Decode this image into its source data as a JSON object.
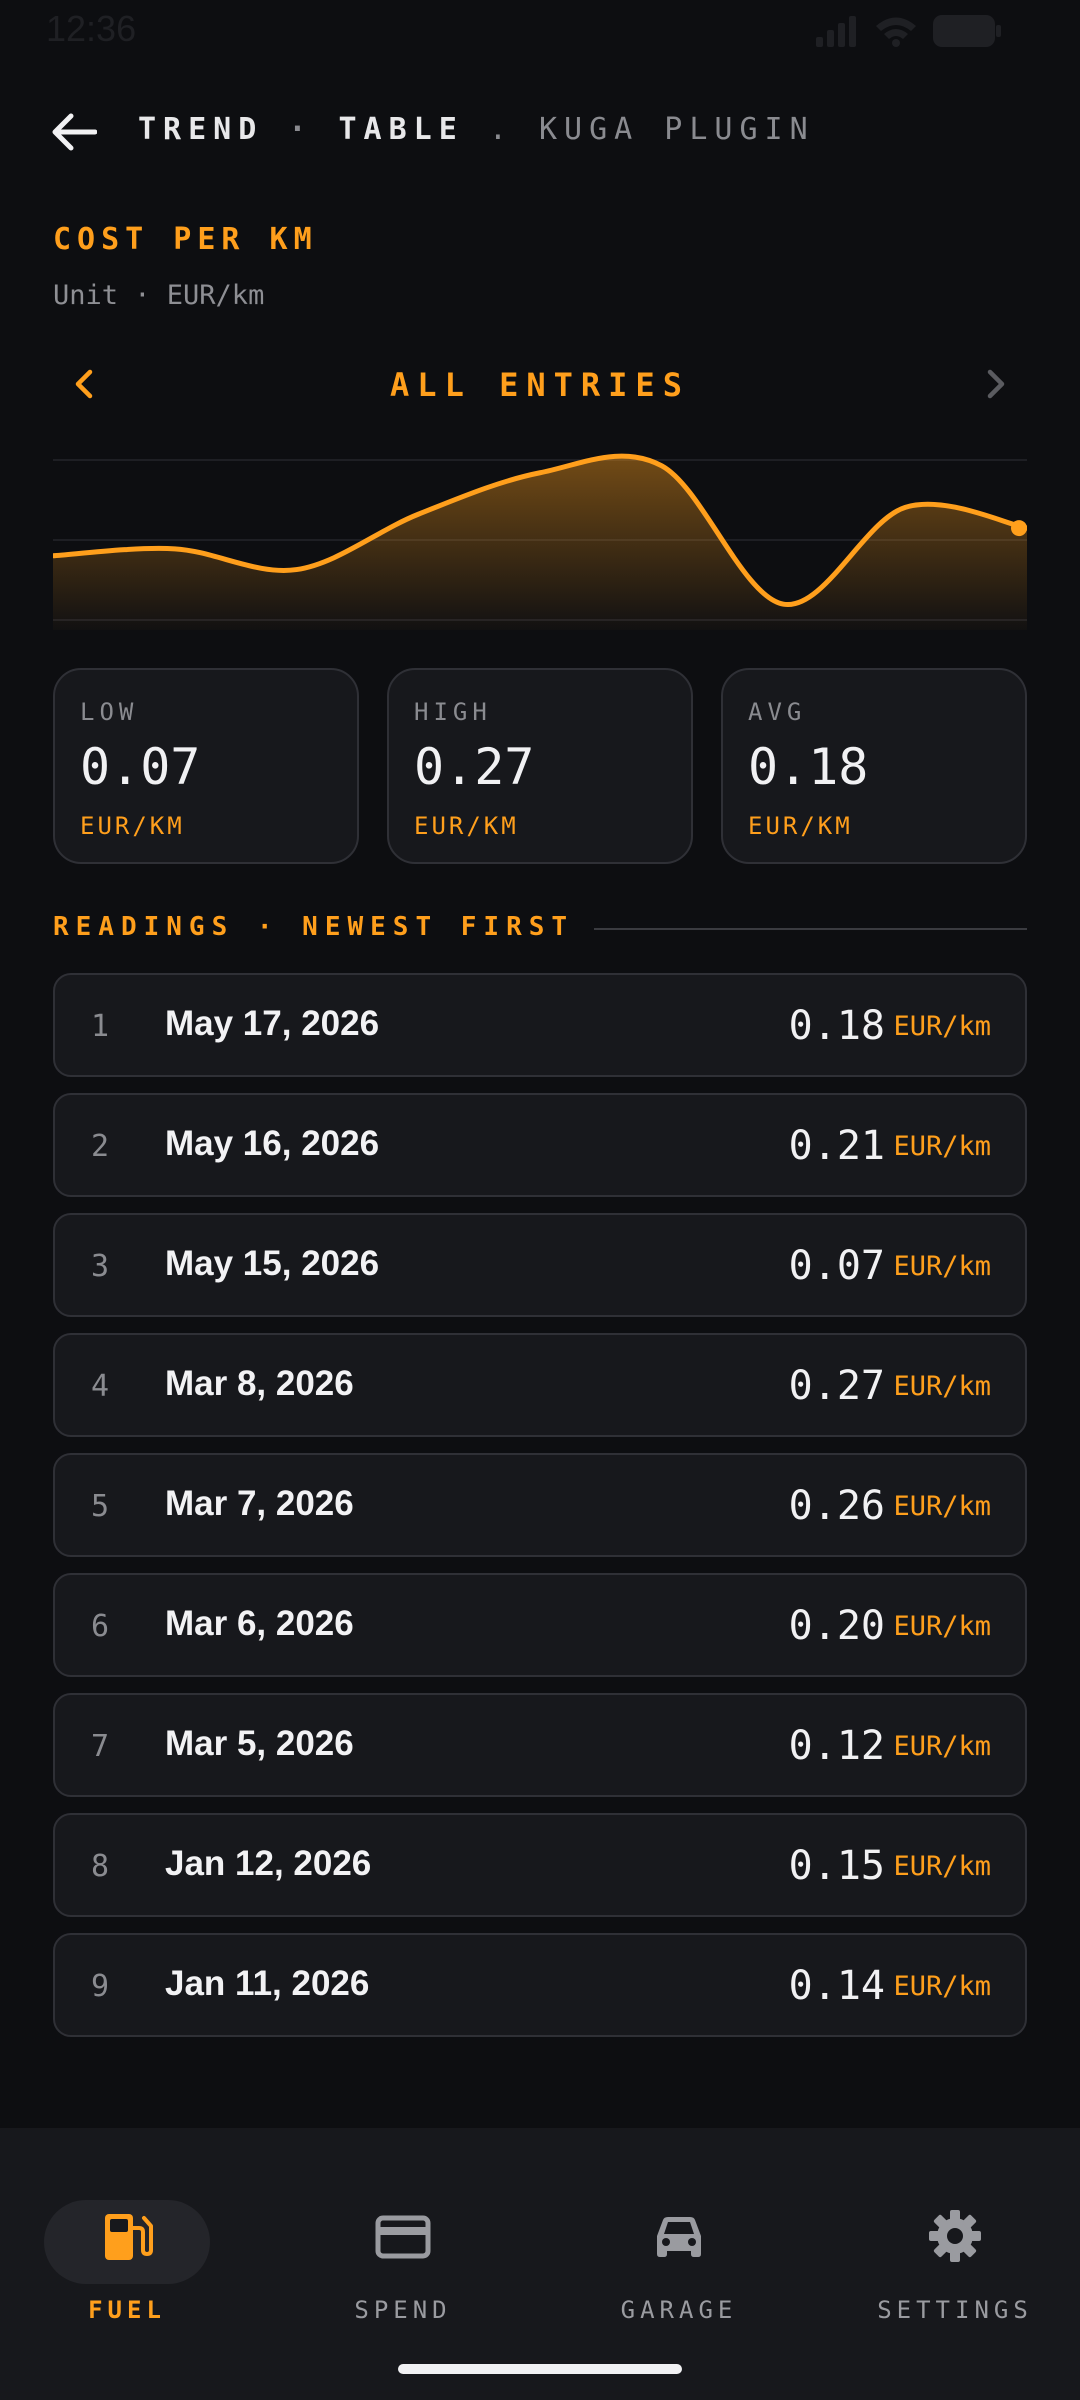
{
  "status": {
    "time": "12:36"
  },
  "header": {
    "crumb_trend": "TREND",
    "crumb_sep": "·",
    "crumb_table": "TABLE",
    "crumb_dot": ".",
    "crumb_vehicle": "KUGA PLUGIN"
  },
  "metric": {
    "title": "COST PER KM",
    "unit_line": "Unit · EUR/km"
  },
  "range": {
    "label": "ALL ENTRIES"
  },
  "colors": {
    "accent": "#ff9f1c",
    "background": "#0d0e11",
    "card": "#17181c"
  },
  "stats": [
    {
      "label": "LOW",
      "value": "0.07",
      "unit": "EUR/KM"
    },
    {
      "label": "HIGH",
      "value": "0.27",
      "unit": "EUR/KM"
    },
    {
      "label": "AVG",
      "value": "0.18",
      "unit": "EUR/KM"
    }
  ],
  "section": {
    "label": "READINGS · NEWEST FIRST"
  },
  "readings": [
    {
      "index": "1",
      "date": "May 17, 2026",
      "value": "0.18",
      "unit": "EUR/km"
    },
    {
      "index": "2",
      "date": "May 16, 2026",
      "value": "0.21",
      "unit": "EUR/km"
    },
    {
      "index": "3",
      "date": "May 15, 2026",
      "value": "0.07",
      "unit": "EUR/km"
    },
    {
      "index": "4",
      "date": "Mar 8, 2026",
      "value": "0.27",
      "unit": "EUR/km"
    },
    {
      "index": "5",
      "date": "Mar 7, 2026",
      "value": "0.26",
      "unit": "EUR/km"
    },
    {
      "index": "6",
      "date": "Mar 6, 2026",
      "value": "0.20",
      "unit": "EUR/km"
    },
    {
      "index": "7",
      "date": "Mar 5, 2026",
      "value": "0.12",
      "unit": "EUR/km"
    },
    {
      "index": "8",
      "date": "Jan 12, 2026",
      "value": "0.15",
      "unit": "EUR/km"
    },
    {
      "index": "9",
      "date": "Jan 11, 2026",
      "value": "0.14",
      "unit": "EUR/km"
    }
  ],
  "chart_data": {
    "type": "area",
    "x": [
      "Jan 11, 2026",
      "Jan 12, 2026",
      "Mar 5, 2026",
      "Mar 6, 2026",
      "Mar 7, 2026",
      "Mar 8, 2026",
      "May 15, 2026",
      "May 16, 2026",
      "May 17, 2026"
    ],
    "values": [
      0.14,
      0.15,
      0.12,
      0.2,
      0.26,
      0.27,
      0.07,
      0.21,
      0.18
    ],
    "ylim": [
      0.05,
      0.29
    ],
    "grid": true,
    "legend": "none",
    "color": "#ff9f1c"
  },
  "nav": [
    {
      "label": "FUEL",
      "icon": "fuel-pump-icon",
      "active": true
    },
    {
      "label": "SPEND",
      "icon": "credit-card-icon",
      "active": false
    },
    {
      "label": "GARAGE",
      "icon": "car-icon",
      "active": false
    },
    {
      "label": "SETTINGS",
      "icon": "gear-icon",
      "active": false
    }
  ]
}
